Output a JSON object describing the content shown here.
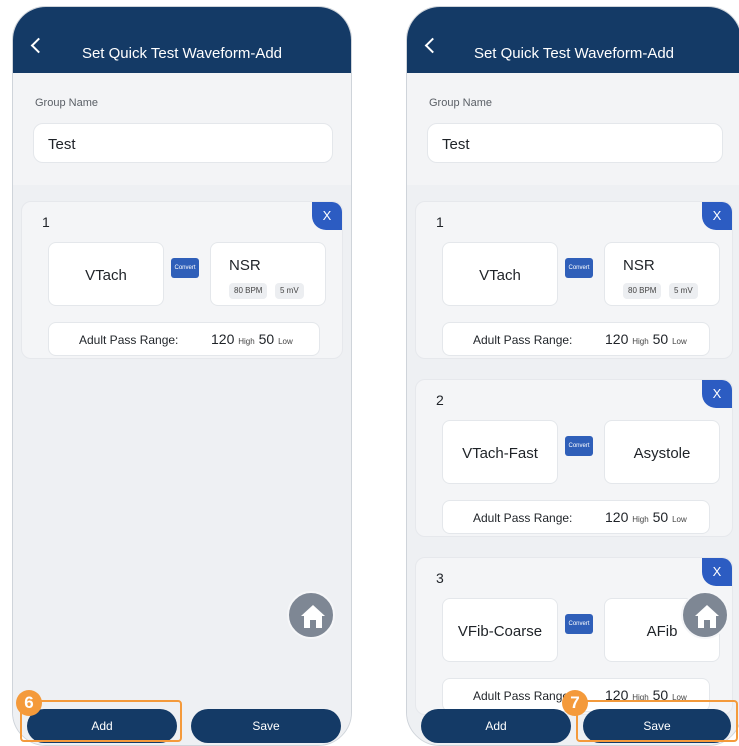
{
  "screen": {
    "title": "Set Quick Test Waveform-Add",
    "group_name_label": "Group Name",
    "group_name_value": "Test",
    "remove_label": "X",
    "convert_label": "Convert"
  },
  "left": {
    "groups": [
      {
        "number": "1",
        "from": "VTach",
        "to": "NSR",
        "to_details": [
          "80 BPM",
          "5 mV"
        ],
        "range_label": "Adult Pass Range:",
        "high": "120",
        "high_unit": "High",
        "low": "50",
        "low_unit": "Low"
      }
    ],
    "add_label": "Add",
    "save_label": "Save",
    "step_badge": "6"
  },
  "right": {
    "groups": [
      {
        "number": "1",
        "from": "VTach",
        "to": "NSR",
        "to_details": [
          "80 BPM",
          "5 mV"
        ],
        "range_label": "Adult Pass Range:",
        "high": "120",
        "high_unit": "High",
        "low": "50",
        "low_unit": "Low"
      },
      {
        "number": "2",
        "from": "VTach-Fast",
        "to": "Asystole",
        "range_label": "Adult Pass Range:",
        "high": "120",
        "high_unit": "High",
        "low": "50",
        "low_unit": "Low"
      },
      {
        "number": "3",
        "from": "VFib-Coarse",
        "to": "AFib",
        "range_label": "Adult Pass Range:",
        "high": "120",
        "high_unit": "High",
        "low": "50",
        "low_unit": "Low"
      }
    ],
    "add_label": "Add",
    "save_label": "Save",
    "step_badge": "7"
  },
  "colors": {
    "header": "#143a66",
    "remove_tab": "#2c5cc2",
    "highlight": "#f49a3b"
  }
}
